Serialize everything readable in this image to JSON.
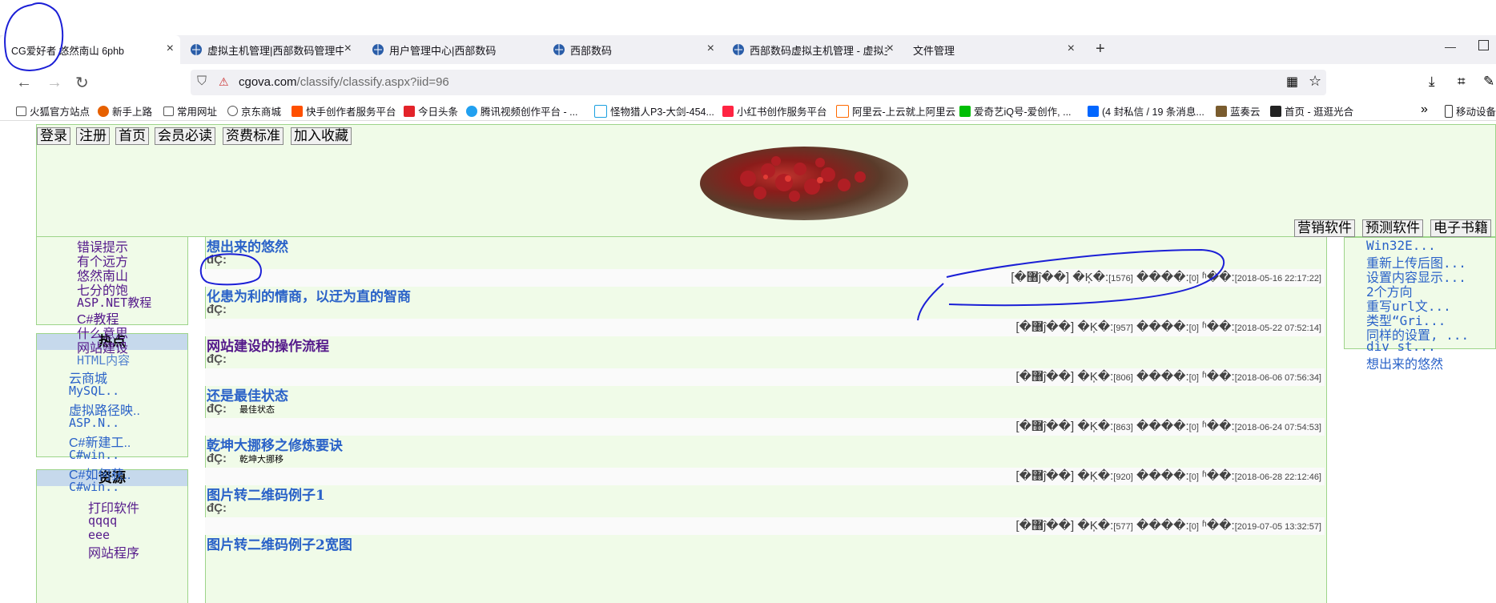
{
  "browser": {
    "tabs": [
      {
        "title": "CG爱好者 悠然南山 6phb",
        "active": true
      },
      {
        "title": "虚拟主机管理|西部数码管理中心"
      },
      {
        "title": "用户管理中心|西部数码"
      },
      {
        "title": "西部数码"
      },
      {
        "title": "西部数码虚拟主机管理 - 虚拟主"
      },
      {
        "title": "文件管理"
      }
    ],
    "url_host": "cgova.com",
    "url_path": "/classify/classify.aspx?iid=96",
    "bookmarks": [
      "火狐官方站点",
      "新手上路",
      "常用网址",
      "京东商城",
      "快手创作者服务平台",
      "今日头条",
      "腾讯视频创作平台 - ...",
      "怪物猎人P3-大剑-454...",
      "小红书创作服务平台",
      "阿里云-上云就上阿里云",
      "爱奇艺iQ号-爱创作, ...",
      "(4 封私信 / 19 条消息...",
      "蓝奏云",
      "首页 - 逛逛光合",
      "移动设备"
    ]
  },
  "header": {
    "top_buttons": [
      "登录",
      "注册",
      "首页",
      "会员必读",
      "资费标准",
      "加入收藏"
    ],
    "right_buttons": [
      "营销软件",
      "预测软件",
      "电子书籍"
    ]
  },
  "sidebar": {
    "category_links": [
      "错误提示",
      "有个远方",
      "悠然南山",
      "七分的饱",
      "ASP.NET教程",
      "C#教程",
      "什么意思",
      "网站建设",
      "HTML内容"
    ],
    "hot_title": "热点",
    "hot_links": [
      "云商城",
      "MySQL..",
      "虚拟路径映..",
      "ASP.N..",
      "C#新建工..",
      "C#win..",
      "C#如何获..",
      "C#win.."
    ],
    "res_title": "资源",
    "res_links": [
      "打印软件",
      "qqqq",
      "eee",
      "网站程序"
    ]
  },
  "articles": [
    {
      "title": "想出来的悠然",
      "summary_label": "đÇ:",
      "summary": "",
      "meta_tag": "[�޸ĵ��]",
      "views_label": "�Ķ�:",
      "views": "[1576]",
      "comments_label": "����:",
      "comments": "[0]",
      "date_label": "ʱ��:",
      "date": "[2018-05-16 22:17:22]"
    },
    {
      "title": "化患为利的情商，以迂为直的智商",
      "summary_label": "đÇ:",
      "summary": "",
      "meta_tag": "[�޸ĵ��]",
      "views_label": "�Ķ�:",
      "views": "[957]",
      "comments_label": "����:",
      "comments": "[0]",
      "date_label": "ʱ��:",
      "date": "[2018-05-22 07:52:14]"
    },
    {
      "title": "网站建设的操作流程",
      "summary_label": "đÇ:",
      "summary": "",
      "meta_tag": "[�޸ĵ��]",
      "views_label": "�Ķ�:",
      "views": "[806]",
      "comments_label": "����:",
      "comments": "[0]",
      "date_label": "ʱ��:",
      "date": "[2018-06-06 07:56:34]"
    },
    {
      "title": "还是最佳状态",
      "summary_label": "đÇ:",
      "summary": "最佳状态",
      "meta_tag": "[�޸ĵ��]",
      "views_label": "�Ķ�:",
      "views": "[863]",
      "comments_label": "����:",
      "comments": "[0]",
      "date_label": "ʱ��:",
      "date": "[2018-06-24 07:54:53]"
    },
    {
      "title": "乾坤大挪移之修炼要诀",
      "summary_label": "đÇ:",
      "summary": "乾坤大挪移",
      "meta_tag": "[�޸ĵ��]",
      "views_label": "�Ķ�:",
      "views": "[920]",
      "comments_label": "����:",
      "comments": "[0]",
      "date_label": "ʱ��:",
      "date": "[2018-06-28 22:12:46]"
    },
    {
      "title": "图片转二维码例子1",
      "summary_label": "đÇ:",
      "summary": "",
      "meta_tag": "[�޸ĵ��]",
      "views_label": "�Ķ�:",
      "views": "[577]",
      "comments_label": "����:",
      "comments": "[0]",
      "date_label": "ʱ��:",
      "date": "[2019-07-05 13:32:57]"
    },
    {
      "title": "图片转二维码例子2宽图"
    }
  ],
  "right_links": [
    "Win32E...",
    "重新上传后图...",
    "设置内容显示...",
    "2个方向",
    "重写url文...",
    "类型“Gri...",
    "同样的设置, ...",
    "div st...",
    "想出来的悠然"
  ]
}
